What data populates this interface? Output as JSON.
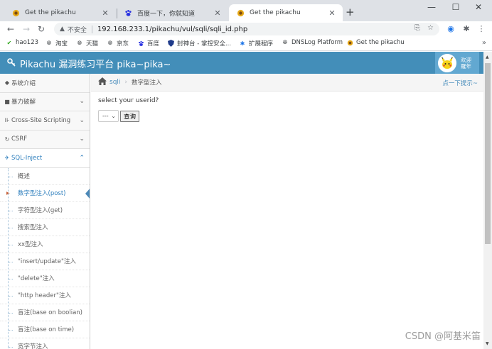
{
  "browser": {
    "tabs": [
      {
        "title": "Get the pikachu",
        "active": false
      },
      {
        "title": "百度一下，你就知道",
        "active": false
      },
      {
        "title": "Get the pikachu",
        "active": true
      }
    ],
    "new_tab_symbol": "+",
    "insecure_label": "不安全",
    "url": "192.168.233.1/pikachu/vul/sqli/sqli_id.php",
    "window_controls": {
      "minimize": "—",
      "maximize": "☐",
      "close": "✕"
    }
  },
  "bookmarks": [
    {
      "label": "hao123",
      "icon": "hao123-icon"
    },
    {
      "label": "淘宝",
      "icon": "globe-icon"
    },
    {
      "label": "天猫",
      "icon": "globe-icon"
    },
    {
      "label": "京东",
      "icon": "globe-icon"
    },
    {
      "label": "百度",
      "icon": "baidu-paw-icon"
    },
    {
      "label": "封神台 - 掌控安全...",
      "icon": "shield-icon"
    },
    {
      "label": "扩展程序",
      "icon": "puzzle-icon"
    },
    {
      "label": "DNSLog Platform",
      "icon": "globe-icon"
    },
    {
      "label": "Get the pikachu",
      "icon": "pikachu-icon"
    }
  ],
  "app": {
    "brand": "Pikachu 漏洞练习平台 pika~pika~",
    "welcome_line1": "欢迎",
    "welcome_line2": "羅年",
    "header_color": "#438eb9"
  },
  "sidebar": {
    "items": [
      {
        "label": "系统介绍",
        "icon": "tags-icon",
        "has_chevron": false
      },
      {
        "label": "暴力破解",
        "icon": "lock-icon",
        "has_chevron": true
      },
      {
        "label": "Cross-Site Scripting",
        "icon": "bug-icon",
        "has_chevron": true
      },
      {
        "label": "CSRF",
        "icon": "refresh-icon",
        "has_chevron": true
      },
      {
        "label": "SQL-Inject",
        "icon": "sql-icon",
        "has_chevron": true,
        "open": true
      }
    ],
    "sub_items": [
      {
        "label": "概述"
      },
      {
        "label": "数字型注入(post)",
        "active": true
      },
      {
        "label": "字符型注入(get)"
      },
      {
        "label": "搜索型注入"
      },
      {
        "label": "xx型注入"
      },
      {
        "label": "\"insert/update\"注入"
      },
      {
        "label": "\"delete\"注入"
      },
      {
        "label": "\"http header\"注入"
      },
      {
        "label": "盲注(base on boolian)"
      },
      {
        "label": "盲注(base on time)"
      },
      {
        "label": "宽字节注入"
      }
    ]
  },
  "breadcrumb": {
    "link": "sqli",
    "current": "数字型注入",
    "tip": "点一下提示~"
  },
  "main": {
    "prompt": "select your userid?",
    "select_value": "---",
    "submit_label": "查询"
  },
  "watermark": "CSDN @阿基米笛"
}
